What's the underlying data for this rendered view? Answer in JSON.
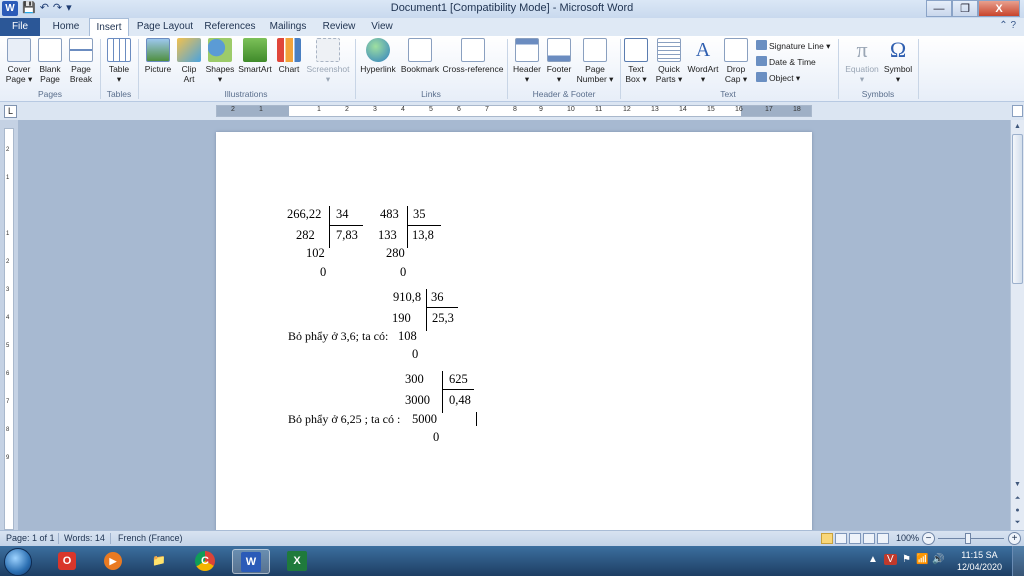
{
  "window": {
    "title": "Document1 [Compatibility Mode] - Microsoft Word",
    "controls": [
      "—",
      "❐",
      "X"
    ]
  },
  "quick_access": [
    "W",
    "💾",
    "↶",
    "↷",
    "▾"
  ],
  "tabs": [
    "File",
    "Home",
    "Insert",
    "Page Layout",
    "References",
    "Mailings",
    "Review",
    "View"
  ],
  "active_tab": "Insert",
  "ribbon": {
    "pages": {
      "cover_page": "Cover\nPage ▾",
      "blank_page": "Blank\nPage",
      "page_break": "Page\nBreak",
      "label": "Pages"
    },
    "tables": {
      "table": "Table\n▾",
      "label": "Tables"
    },
    "illustrations": {
      "picture": "Picture",
      "clip_art": "Clip\nArt",
      "shapes": "Shapes\n▾",
      "smartart": "SmartArt",
      "chart": "Chart",
      "screenshot": "Screenshot\n▾",
      "label": "Illustrations"
    },
    "links": {
      "hyperlink": "Hyperlink",
      "bookmark": "Bookmark",
      "cross_reference": "Cross-reference",
      "label": "Links"
    },
    "header_footer": {
      "header": "Header\n▾",
      "footer": "Footer\n▾",
      "page_number": "Page\nNumber ▾",
      "label": "Header & Footer"
    },
    "text": {
      "text_box": "Text\nBox ▾",
      "quick_parts": "Quick\nParts ▾",
      "wordart": "WordArt\n▾",
      "drop_cap": "Drop\nCap ▾",
      "signature_line": "Signature Line ▾",
      "date_time": "Date & Time",
      "object": "Object ▾",
      "label": "Text"
    },
    "symbols": {
      "equation": "Equation\n▾",
      "symbol": "Symbol\n▾",
      "label": "Symbols"
    }
  },
  "ruler": {
    "numbers": [
      "2",
      "1",
      "1",
      "2",
      "3",
      "4",
      "5",
      "6",
      "7",
      "8",
      "9",
      "10",
      "11",
      "12",
      "13",
      "14",
      "15",
      "16",
      "17",
      "18"
    ]
  },
  "document": {
    "div1": {
      "dividend": "266,22",
      "divisor": "34",
      "step1": "282",
      "quotient": "7,83",
      "step2": "102",
      "remainder": "0"
    },
    "div2": {
      "dividend": "483",
      "divisor": "35",
      "step1": "133",
      "quotient": "13,8",
      "step2": "280",
      "remainder": "0"
    },
    "div3": {
      "dividend": "910,8",
      "divisor": "36",
      "step1": "190",
      "quotient": "25,3",
      "note": "Bỏ phẩy ở 3,6; ta có:",
      "step2": "108",
      "remainder": "0"
    },
    "div4": {
      "dividend": "300",
      "divisor": "625",
      "step1": "3000",
      "quotient": "0,48",
      "note": "Bỏ phẩy ở 6,25 ; ta có :",
      "step2": "5000",
      "remainder": "0"
    }
  },
  "status": {
    "page": "Page: 1 of 1",
    "words": "Words: 14",
    "language": "French (France)",
    "zoom": "100%",
    "zoom_minus": "−",
    "zoom_plus": "+"
  },
  "taskbar": {
    "apps": [
      "O",
      "▶",
      "📁",
      "C",
      "W",
      "X"
    ],
    "time": "11:15 SA",
    "date": "12/04/2020"
  }
}
